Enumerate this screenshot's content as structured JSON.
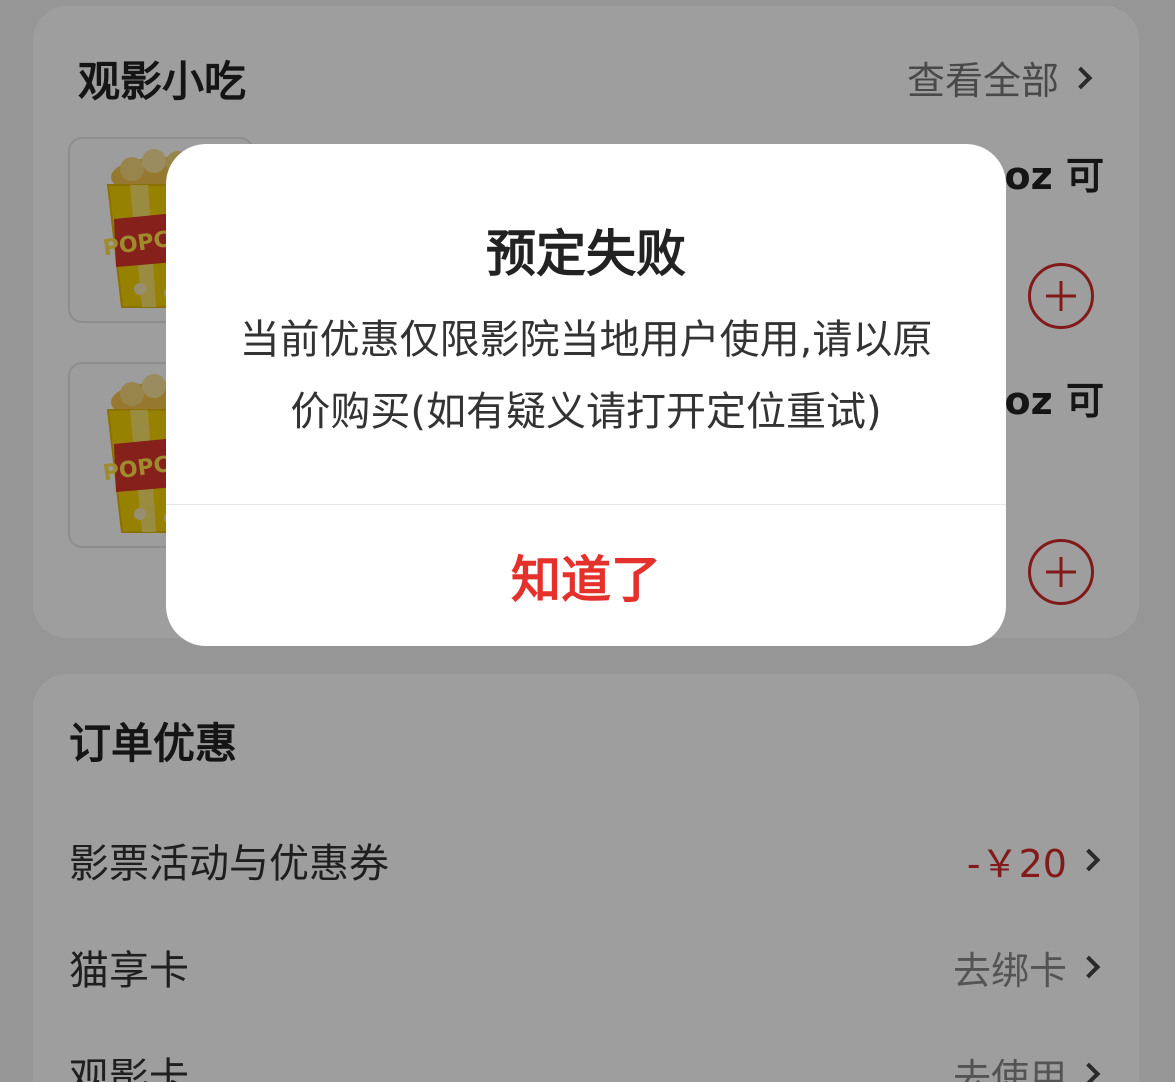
{
  "snacks": {
    "title": "观影小吃",
    "view_all_label": "查看全部",
    "items": [
      {
        "name_visible_fragment": "oz 可",
        "image": "popcorn-bucket",
        "thumb_text": "POPCORN"
      },
      {
        "name_visible_fragment": "oz 可",
        "image": "popcorn-bucket",
        "thumb_text": "POPCORN"
      }
    ]
  },
  "order_discounts": {
    "title": "订单优惠",
    "rows": [
      {
        "label": "影票活动与优惠券",
        "value": "-￥20"
      },
      {
        "label": "猫享卡",
        "value": "去绑卡"
      },
      {
        "label": "观影卡",
        "value": "去使用"
      }
    ]
  },
  "dialog": {
    "title": "预定失败",
    "message": "当前优惠仅限影院当地用户使用,请以原价购买(如有疑义请打开定位重试)",
    "confirm_label": "知道了"
  },
  "colors": {
    "accent_red": "#e4312b",
    "plus_red": "#d42a2a",
    "overlay": "rgba(0,0,0,0.38)"
  }
}
